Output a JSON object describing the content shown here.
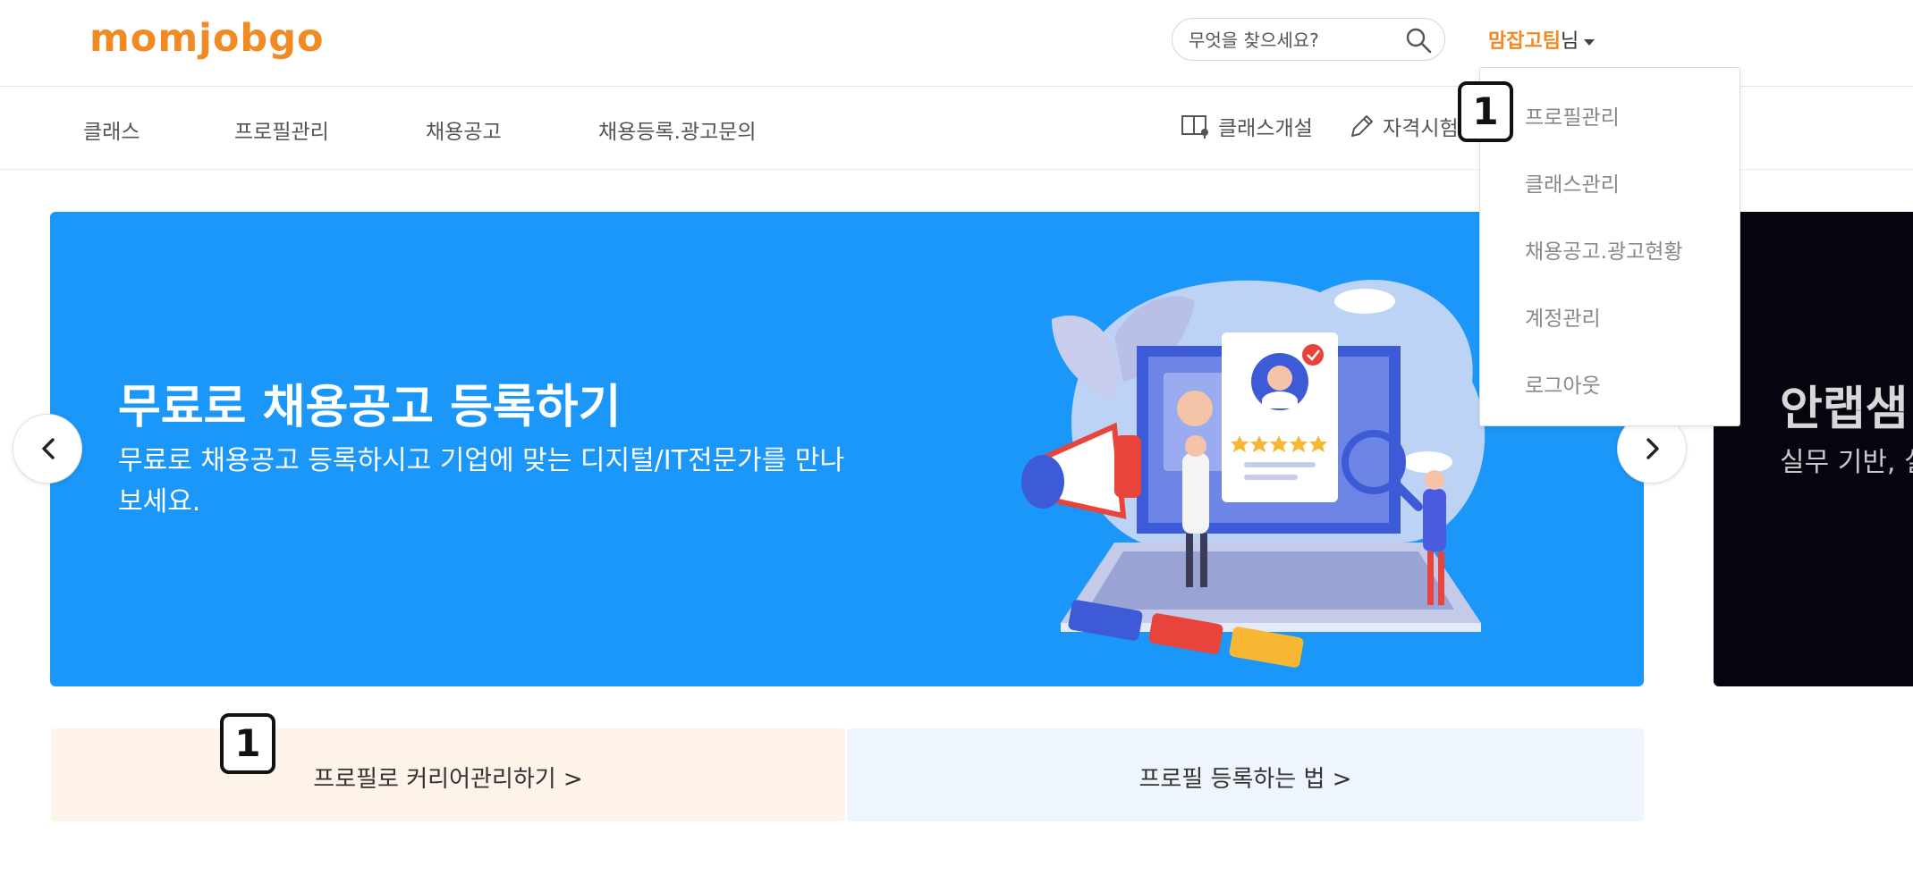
{
  "header": {
    "logo_text": "momjobgo",
    "search_placeholder": "무엇을 찾으세요?",
    "search_icon": "search-icon",
    "user_name": "맘잡고팀",
    "user_suffix": "님",
    "brand_color": "#f08a24"
  },
  "nav": {
    "items": [
      {
        "label": "클래스"
      },
      {
        "label": "프로필관리"
      },
      {
        "label": "채용공고"
      },
      {
        "label": "채용등록.광고문의"
      }
    ],
    "right": [
      {
        "label": "클래스개설",
        "icon": "book-icon"
      },
      {
        "label": "자격시험",
        "icon": "pencil-icon"
      }
    ]
  },
  "dropdown": {
    "items": [
      {
        "label": "프로필관리"
      },
      {
        "label": "클래스관리"
      },
      {
        "label": "채용공고.광고현황"
      },
      {
        "label": "계정관리"
      },
      {
        "label": "로그아웃"
      }
    ]
  },
  "banner": {
    "title": "무료로 채용공고 등록하기",
    "description": "무료로 채용공고 등록하시고 기업에 맞는 디지털/IT전문가를 만나보세요.",
    "background": "#1a97f8"
  },
  "banner_next": {
    "title": "안랩샘",
    "description": "실무 기반, 실 어 패스의 완"
  },
  "carousel": {
    "prev_icon": "chevron-left-icon",
    "next_icon": "chevron-right-icon"
  },
  "info": {
    "left_text": "프로필로 커리어관리하기 >",
    "right_text": "프로필 등록하는 법 >"
  },
  "markers": {
    "first": "1",
    "second": "1"
  }
}
